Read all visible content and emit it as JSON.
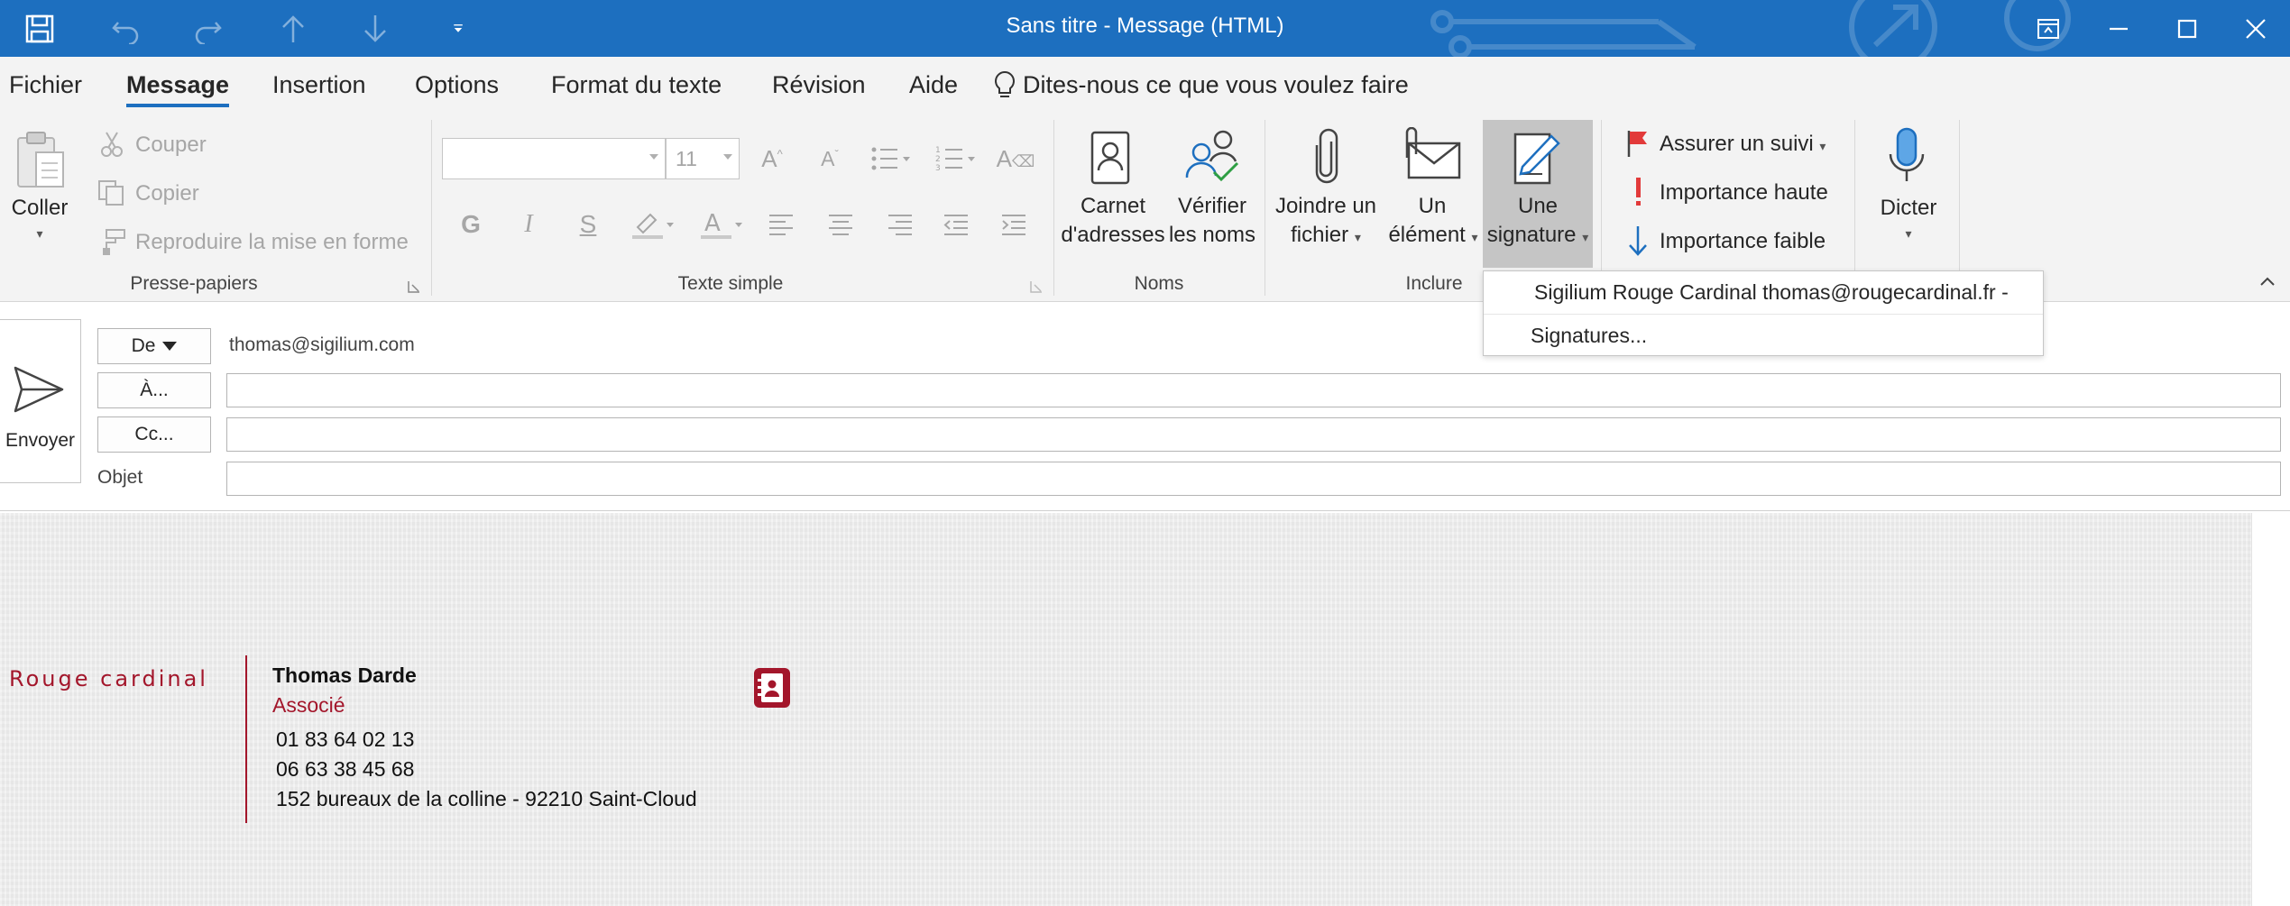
{
  "window": {
    "title": "Sans titre  -  Message (HTML)",
    "titlebar_color": "#1d6fbf"
  },
  "menu": {
    "tabs": [
      "Fichier",
      "Message",
      "Insertion",
      "Options",
      "Format du texte",
      "Révision",
      "Aide"
    ],
    "active": "Message",
    "tell_me": "Dites-nous ce que vous voulez faire"
  },
  "ribbon": {
    "clipboard": {
      "paste": "Coller",
      "cut": "Couper",
      "copy": "Copier",
      "format_painter": "Reproduire la mise en forme",
      "label": "Presse-papiers"
    },
    "basic_text": {
      "font_name": "",
      "font_size": "11",
      "bold": "G",
      "italic": "I",
      "underline": "S",
      "label": "Texte simple"
    },
    "names": {
      "address_book_l1": "Carnet",
      "address_book_l2": "d'adresses",
      "check_names_l1": "Vérifier",
      "check_names_l2": "les noms",
      "label": "Noms"
    },
    "include": {
      "attach_l1": "Joindre un",
      "attach_l2": "fichier",
      "item_l1": "Un",
      "item_l2": "élément",
      "signature_l1": "Une",
      "signature_l2": "signature",
      "label": "Inclure"
    },
    "tags": {
      "follow_up": "Assurer un suivi",
      "high_importance": "Importance haute",
      "low_importance": "Importance faible"
    },
    "voice": {
      "dictate": "Dicter"
    }
  },
  "signature_menu": {
    "items": [
      "Sigilium Rouge Cardinal thomas@rougecardinal.fr -",
      "Signatures..."
    ]
  },
  "header": {
    "send": "Envoyer",
    "from_label": "De",
    "from_value": "thomas@sigilium.com",
    "to_label": "À...",
    "to_value": "",
    "cc_label": "Cc...",
    "cc_value": "",
    "subject_label": "Objet",
    "subject_value": ""
  },
  "signature": {
    "logo": "Rouge cardinal",
    "name": "Thomas Darde",
    "role": "Associé",
    "phone1": "01 83 64 02 13",
    "phone2": "06 63 38 45 68",
    "address": "152 bureaux de la colline - 92210 Saint-Cloud",
    "accent_color": "#a3162b"
  }
}
